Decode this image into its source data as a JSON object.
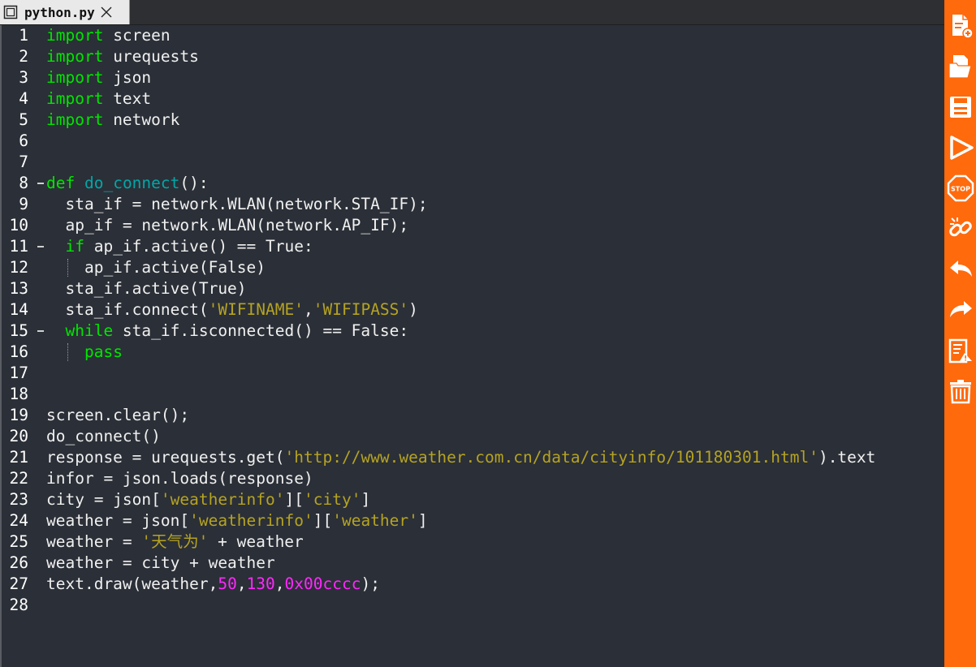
{
  "tab": {
    "filename": "python.py"
  },
  "code": [
    [
      [
        "kw",
        "import"
      ],
      [
        "p",
        " screen"
      ]
    ],
    [
      [
        "kw",
        "import"
      ],
      [
        "p",
        " urequests"
      ]
    ],
    [
      [
        "kw",
        "import"
      ],
      [
        "p",
        " json"
      ]
    ],
    [
      [
        "kw",
        "import"
      ],
      [
        "p",
        " text"
      ]
    ],
    [
      [
        "kw",
        "import"
      ],
      [
        "p",
        " network"
      ]
    ],
    [],
    [],
    [
      [
        "kw",
        "def"
      ],
      [
        "p",
        " "
      ],
      [
        "fn",
        "do_connect"
      ],
      [
        "p",
        "():"
      ]
    ],
    [
      [
        "p",
        "  sta_if = network.WLAN(network.STA_IF);"
      ]
    ],
    [
      [
        "p",
        "  ap_if = network.WLAN(network.AP_IF);"
      ]
    ],
    [
      [
        "p",
        "  "
      ],
      [
        "kw",
        "if"
      ],
      [
        "p",
        " ap_if.active() == True:"
      ]
    ],
    [
      [
        "p",
        "    ap_if.active(False)"
      ]
    ],
    [
      [
        "p",
        "  sta_if.active(True)"
      ]
    ],
    [
      [
        "p",
        "  sta_if.connect("
      ],
      [
        "str",
        "'WIFINAME'"
      ],
      [
        "p",
        ","
      ],
      [
        "str",
        "'WIFIPASS'"
      ],
      [
        "p",
        ")"
      ]
    ],
    [
      [
        "p",
        "  "
      ],
      [
        "kw",
        "while"
      ],
      [
        "p",
        " sta_if.isconnected() == False:"
      ]
    ],
    [
      [
        "p",
        "    "
      ],
      [
        "kw",
        "pass"
      ]
    ],
    [],
    [],
    [
      [
        "p",
        "screen.clear();"
      ]
    ],
    [
      [
        "p",
        "do_connect()"
      ]
    ],
    [
      [
        "p",
        "response = urequests.get("
      ],
      [
        "str",
        "'http://www.weather.com.cn/data/cityinfo/101180301.html'"
      ],
      [
        "p",
        ").text"
      ]
    ],
    [
      [
        "p",
        "infor = json.loads(response)"
      ]
    ],
    [
      [
        "p",
        "city = json["
      ],
      [
        "str",
        "'weatherinfo'"
      ],
      [
        "p",
        "]["
      ],
      [
        "str",
        "'city'"
      ],
      [
        "p",
        "]"
      ]
    ],
    [
      [
        "p",
        "weather = json["
      ],
      [
        "str",
        "'weatherinfo'"
      ],
      [
        "p",
        "]["
      ],
      [
        "str",
        "'weather'"
      ],
      [
        "p",
        "]"
      ]
    ],
    [
      [
        "p",
        "weather = "
      ],
      [
        "str",
        "'天气为'"
      ],
      [
        "p",
        " + weather"
      ]
    ],
    [
      [
        "p",
        "weather = city + weather"
      ]
    ],
    [
      [
        "p",
        "text.draw(weather,"
      ],
      [
        "num",
        "50"
      ],
      [
        "p",
        ","
      ],
      [
        "num",
        "130"
      ],
      [
        "p",
        ","
      ],
      [
        "num",
        "0x00cccc"
      ],
      [
        "p",
        ");"
      ]
    ],
    []
  ],
  "fold_lines": [
    8,
    11,
    15
  ],
  "toolbar": [
    {
      "name": "new-file-button",
      "icon": "new-file-icon"
    },
    {
      "name": "open-file-button",
      "icon": "open-folder-icon"
    },
    {
      "name": "save-button",
      "icon": "save-icon"
    },
    {
      "name": "run-button",
      "icon": "play-icon"
    },
    {
      "name": "stop-button",
      "icon": "stop-icon"
    },
    {
      "name": "connect-button",
      "icon": "link-icon"
    },
    {
      "name": "undo-button",
      "icon": "undo-icon"
    },
    {
      "name": "redo-button",
      "icon": "redo-icon"
    },
    {
      "name": "check-button",
      "icon": "checklist-icon"
    },
    {
      "name": "delete-button",
      "icon": "trash-icon"
    }
  ],
  "colors": {
    "editor_bg": "#2b2f37",
    "keyword": "#00e600",
    "function_name": "#00a8a8",
    "string": "#b5a322",
    "number": "#ff28ff",
    "toolbar_bg": "#ff6a0d"
  }
}
